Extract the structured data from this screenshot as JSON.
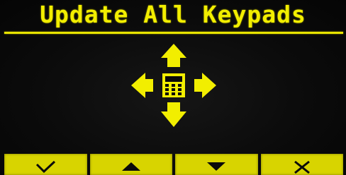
{
  "screen": {
    "title": "Update All Keypads"
  },
  "colors": {
    "background": "#050505",
    "display_yellow": "#f2ee00",
    "softkey_fill": "#d8d400",
    "icon_dark": "#0a0a0a"
  },
  "icons": {
    "center": "keypad-icon",
    "arrows": [
      "arrow-up-icon",
      "arrow-left-icon",
      "arrow-right-icon",
      "arrow-down-icon"
    ]
  },
  "softkeys": [
    {
      "name": "confirm",
      "icon": "check-icon"
    },
    {
      "name": "up",
      "icon": "triangle-up-icon"
    },
    {
      "name": "down",
      "icon": "triangle-down-icon"
    },
    {
      "name": "cancel",
      "icon": "cross-icon"
    }
  ]
}
